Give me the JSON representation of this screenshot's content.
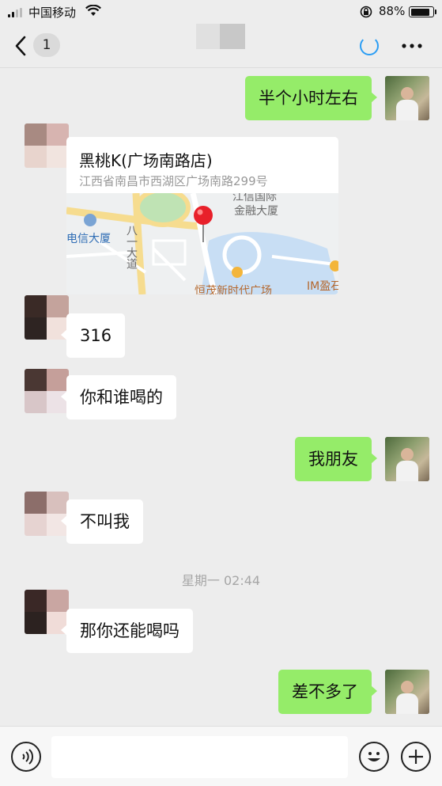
{
  "status_bar": {
    "carrier": "中国移动",
    "battery_percent": "88%",
    "battery_level": 0.88
  },
  "nav": {
    "unread_count": "1",
    "icons": [
      "back-arrow-icon",
      "loading-icon",
      "more-icon"
    ]
  },
  "messages": [
    {
      "side": "out",
      "text": "半个小时左右"
    },
    {
      "side": "in",
      "type": "location",
      "name": "黑桃K(广场南路店)",
      "address": "江西省南昌市西湖区广场南路299号",
      "map_labels": [
        "江信国际",
        "金融大厦",
        "电信大厦",
        "八一大道",
        "恒茂新时代广场",
        "IM盈石"
      ]
    },
    {
      "side": "in",
      "text": "316"
    },
    {
      "side": "in",
      "text": "你和谁喝的"
    },
    {
      "side": "out",
      "text": "我朋友"
    },
    {
      "side": "in",
      "text": "不叫我"
    },
    {
      "side": "in",
      "text": "那你还能喝吗"
    },
    {
      "side": "out",
      "text": "差不多了"
    }
  ],
  "time_separator": "星期一 02:44",
  "input_bar": {
    "message_value": "",
    "icons": [
      "voice-icon",
      "emoji-icon",
      "plus-icon"
    ]
  },
  "colors": {
    "background": "#ededed",
    "outgoing_bubble": "#95ec69",
    "incoming_bubble": "#ffffff",
    "map_pin": "#e8202a"
  }
}
